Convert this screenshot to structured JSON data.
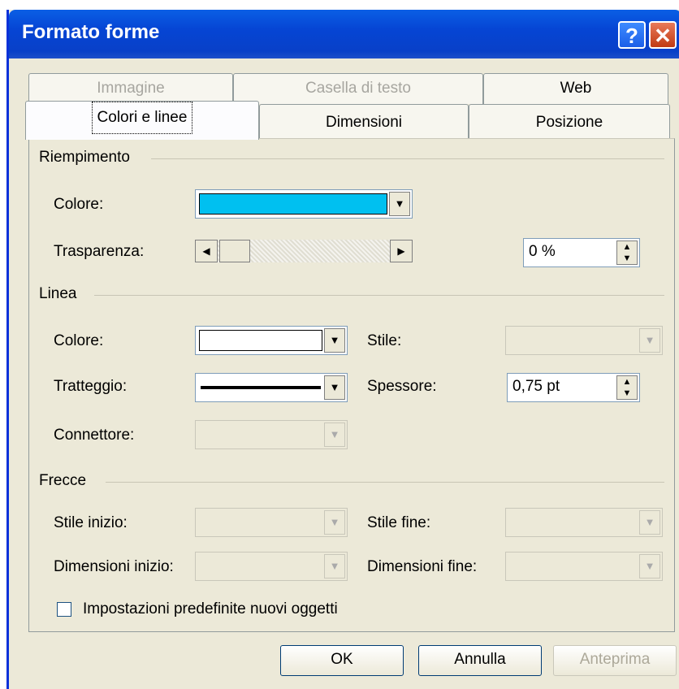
{
  "window": {
    "title": "Formato forme",
    "help_icon": "?",
    "close_icon": "✕"
  },
  "tabs_back": [
    "Immagine",
    "Casella di testo",
    "Web"
  ],
  "tabs_front": [
    "Colori e linee",
    "Dimensioni",
    "Posizione"
  ],
  "fill": {
    "section": "Riempimento",
    "color_label": "Colore:",
    "color_value": "#00c0f0",
    "transparency_label": "Trasparenza:",
    "transparency_value": "0 %"
  },
  "line": {
    "section": "Linea",
    "color_label": "Colore:",
    "style_label": "Stile:",
    "dash_label": "Tratteggio:",
    "weight_label": "Spessore:",
    "weight_value": "0,75 pt",
    "connector_label": "Connettore:"
  },
  "arrows": {
    "section": "Frecce",
    "begin_style": "Stile inizio:",
    "end_style": "Stile fine:",
    "begin_size": "Dimensioni inizio:",
    "end_size": "Dimensioni fine:"
  },
  "default_checkbox": "Impostazioni predefinite nuovi oggetti",
  "buttons": {
    "ok": "OK",
    "cancel": "Annulla",
    "preview": "Anteprima"
  }
}
